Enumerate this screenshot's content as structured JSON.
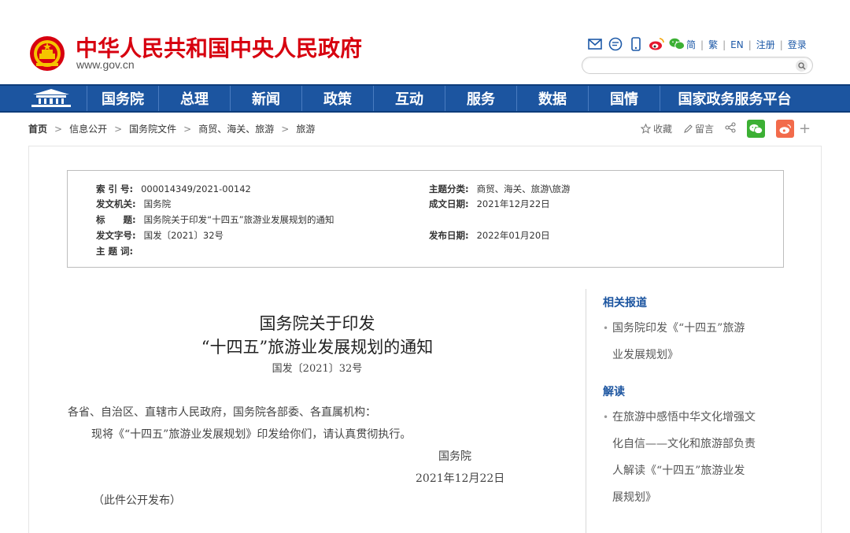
{
  "header": {
    "site_name": "中华人民共和国中央人民政府",
    "site_url": "www.gov.cn",
    "icons": [
      "mail-icon",
      "message-icon",
      "mobile-icon",
      "weibo-icon",
      "wechat-icon"
    ],
    "links": [
      "简",
      "繁",
      "EN",
      "注册",
      "登录"
    ],
    "search_placeholder": ""
  },
  "nav": {
    "items": [
      "国务院",
      "总理",
      "新闻",
      "政策",
      "互动",
      "服务",
      "数据",
      "国情",
      "国家政务服务平台"
    ]
  },
  "breadcrumb": [
    "首页",
    "信息公开",
    "国务院文件",
    "商贸、海关、旅游",
    "旅游"
  ],
  "tools": {
    "favorite": "收藏",
    "comment": "留言"
  },
  "meta": {
    "index_no_label": "索 引 号:",
    "index_no": "000014349/2021-00142",
    "issuer_label": "发文机关:",
    "issuer": "国务院",
    "title_label": "标　　题:",
    "title": "国务院关于印发“十四五”旅游业发展规划的通知",
    "doc_no_label": "发文字号:",
    "doc_no": "国发〔2021〕32号",
    "keywords_label": "主 题 词:",
    "keywords": "",
    "topic_label": "主题分类:",
    "topic": "商贸、海关、旅游\\旅游",
    "written_label": "成文日期:",
    "written_date": "2021年12月22日",
    "published_label": "发布日期:",
    "published_date": "2022年01月20日"
  },
  "article": {
    "title_line1": "国务院关于印发",
    "title_line2": "“十四五”旅游业发展规划的通知",
    "doc_number": "国发〔2021〕32号",
    "salutation": "各省、自治区、直辖市人民政府，国务院各部委、各直属机构：",
    "body": "现将《“十四五”旅游业发展规划》印发给你们，请认真贯彻执行。",
    "signer": "国务院",
    "date": "2021年12月22日",
    "note": "（此件公开发布）"
  },
  "sidebar": {
    "related_title": "相关报道",
    "related_items": [
      [
        "国务院印发《“十四五”旅游",
        "业发展规划》"
      ]
    ],
    "interpret_title": "解读",
    "interpret_items": [
      [
        "在旅游中感悟中华文化增强文",
        "化自信——文化和旅游部负责",
        "人解读《“十四五”旅游业发",
        "展规划》"
      ]
    ]
  },
  "colors": {
    "brand_red": "#d7000f",
    "nav_blue": "#1c55a0",
    "wechat_green": "#3cb034",
    "weibo_orange": "#f26b4b"
  }
}
